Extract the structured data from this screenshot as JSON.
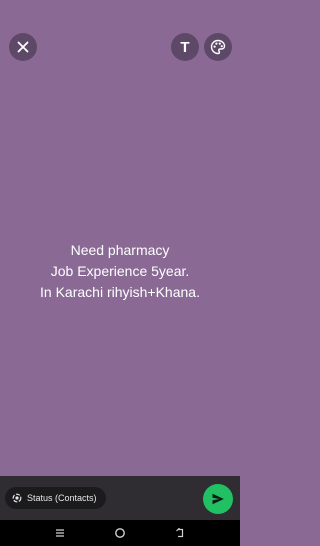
{
  "toolbar": {
    "close_icon": "close-icon",
    "text_tool_label": "T",
    "palette_icon": "palette-icon"
  },
  "status": {
    "background_color": "#8a6a95",
    "lines": [
      "Need pharmacy",
      "Job Experience 5year.",
      "In Karachi rihyish+Khana."
    ]
  },
  "footer": {
    "audience_label": "Status (Contacts)",
    "audience_icon": "status-icon",
    "send_icon": "send-icon",
    "send_color": "#21c063"
  },
  "navigation": {
    "icons": [
      "recent-apps-icon",
      "home-icon",
      "back-icon"
    ]
  }
}
